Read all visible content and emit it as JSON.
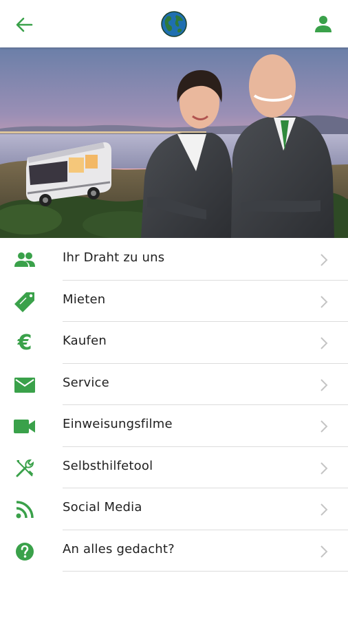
{
  "colors": {
    "accent": "#3aa14a",
    "divider": "#dcdcdc",
    "chevron": "#c4c4c4"
  },
  "topbar": {
    "back_icon": "arrow-left-icon",
    "logo_icon": "globe-icon",
    "profile_icon": "user-icon"
  },
  "hero": {
    "image": "motorhome-and-two-people-photo"
  },
  "menu": {
    "items": [
      {
        "label": "Ihr Draht zu uns",
        "icon": "people-icon"
      },
      {
        "label": "Mieten",
        "icon": "rent-tag-icon"
      },
      {
        "label": "Kaufen",
        "icon": "euro-icon",
        "glyph": "€"
      },
      {
        "label": "Service",
        "icon": "envelope-icon"
      },
      {
        "label": "Einweisungsfilme",
        "icon": "video-camera-icon"
      },
      {
        "label": "Selbsthilfetool",
        "icon": "tools-icon"
      },
      {
        "label": "Social Media",
        "icon": "rss-icon"
      },
      {
        "label": "An alles gedacht?",
        "icon": "help-circle-icon"
      }
    ]
  }
}
